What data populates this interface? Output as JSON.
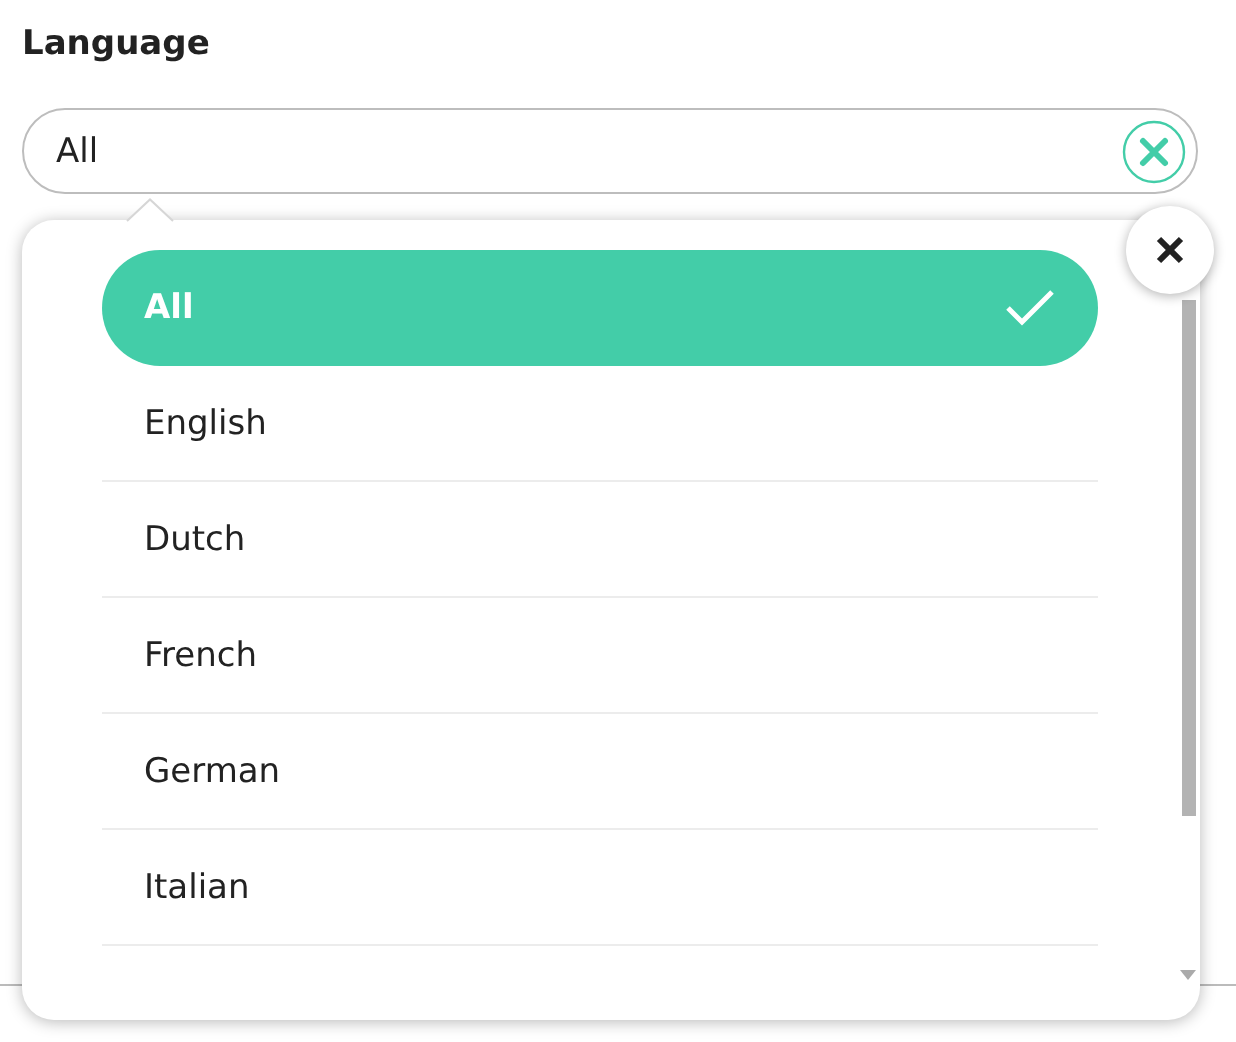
{
  "label": "Language",
  "field": {
    "value": "All"
  },
  "options": [
    {
      "label": "All",
      "selected": true
    },
    {
      "label": "English",
      "selected": false
    },
    {
      "label": "Dutch",
      "selected": false
    },
    {
      "label": "French",
      "selected": false
    },
    {
      "label": "German",
      "selected": false
    },
    {
      "label": "Italian",
      "selected": false
    }
  ]
}
